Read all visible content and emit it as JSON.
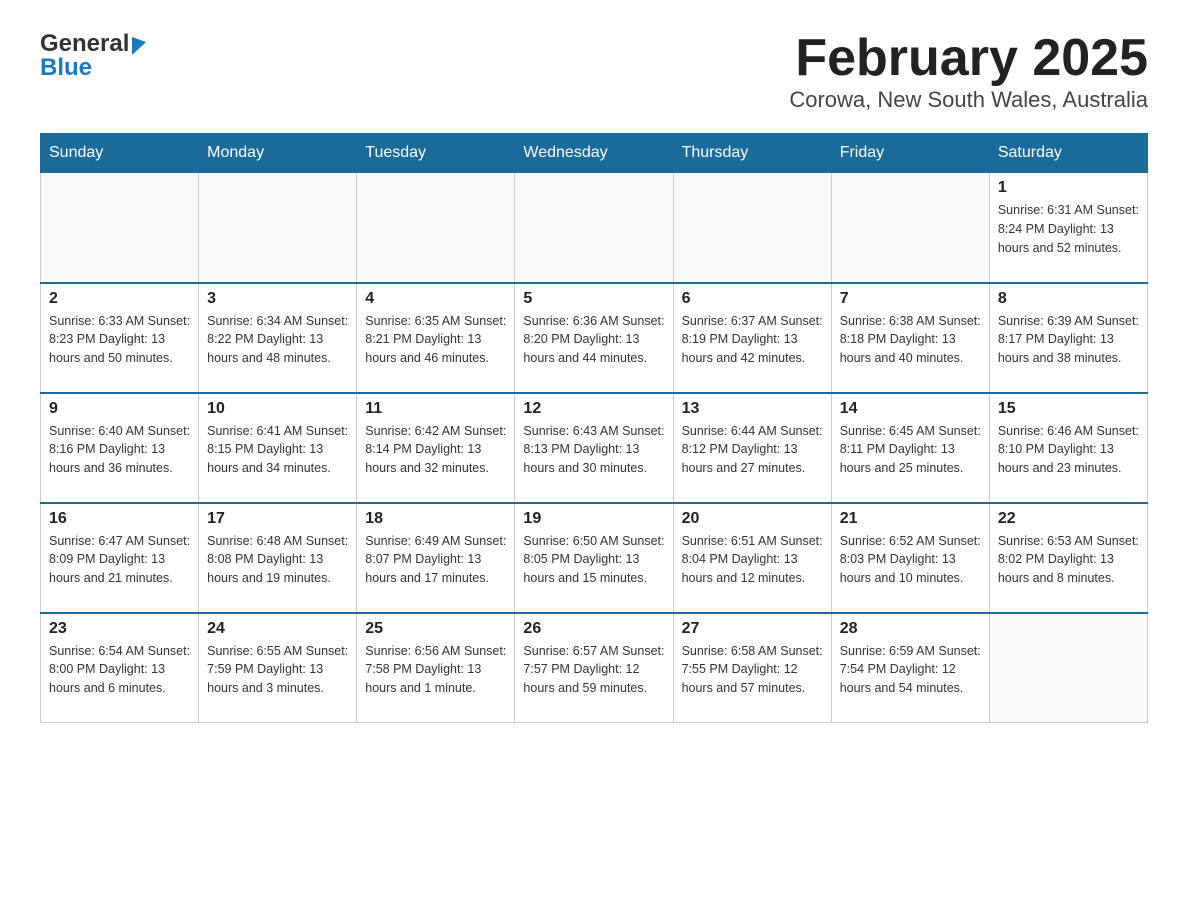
{
  "header": {
    "logo_general": "General",
    "logo_blue": "Blue",
    "title": "February 2025",
    "subtitle": "Corowa, New South Wales, Australia"
  },
  "calendar": {
    "days_of_week": [
      "Sunday",
      "Monday",
      "Tuesday",
      "Wednesday",
      "Thursday",
      "Friday",
      "Saturday"
    ],
    "weeks": [
      [
        {
          "day": "",
          "info": ""
        },
        {
          "day": "",
          "info": ""
        },
        {
          "day": "",
          "info": ""
        },
        {
          "day": "",
          "info": ""
        },
        {
          "day": "",
          "info": ""
        },
        {
          "day": "",
          "info": ""
        },
        {
          "day": "1",
          "info": "Sunrise: 6:31 AM\nSunset: 8:24 PM\nDaylight: 13 hours and 52 minutes."
        }
      ],
      [
        {
          "day": "2",
          "info": "Sunrise: 6:33 AM\nSunset: 8:23 PM\nDaylight: 13 hours and 50 minutes."
        },
        {
          "day": "3",
          "info": "Sunrise: 6:34 AM\nSunset: 8:22 PM\nDaylight: 13 hours and 48 minutes."
        },
        {
          "day": "4",
          "info": "Sunrise: 6:35 AM\nSunset: 8:21 PM\nDaylight: 13 hours and 46 minutes."
        },
        {
          "day": "5",
          "info": "Sunrise: 6:36 AM\nSunset: 8:20 PM\nDaylight: 13 hours and 44 minutes."
        },
        {
          "day": "6",
          "info": "Sunrise: 6:37 AM\nSunset: 8:19 PM\nDaylight: 13 hours and 42 minutes."
        },
        {
          "day": "7",
          "info": "Sunrise: 6:38 AM\nSunset: 8:18 PM\nDaylight: 13 hours and 40 minutes."
        },
        {
          "day": "8",
          "info": "Sunrise: 6:39 AM\nSunset: 8:17 PM\nDaylight: 13 hours and 38 minutes."
        }
      ],
      [
        {
          "day": "9",
          "info": "Sunrise: 6:40 AM\nSunset: 8:16 PM\nDaylight: 13 hours and 36 minutes."
        },
        {
          "day": "10",
          "info": "Sunrise: 6:41 AM\nSunset: 8:15 PM\nDaylight: 13 hours and 34 minutes."
        },
        {
          "day": "11",
          "info": "Sunrise: 6:42 AM\nSunset: 8:14 PM\nDaylight: 13 hours and 32 minutes."
        },
        {
          "day": "12",
          "info": "Sunrise: 6:43 AM\nSunset: 8:13 PM\nDaylight: 13 hours and 30 minutes."
        },
        {
          "day": "13",
          "info": "Sunrise: 6:44 AM\nSunset: 8:12 PM\nDaylight: 13 hours and 27 minutes."
        },
        {
          "day": "14",
          "info": "Sunrise: 6:45 AM\nSunset: 8:11 PM\nDaylight: 13 hours and 25 minutes."
        },
        {
          "day": "15",
          "info": "Sunrise: 6:46 AM\nSunset: 8:10 PM\nDaylight: 13 hours and 23 minutes."
        }
      ],
      [
        {
          "day": "16",
          "info": "Sunrise: 6:47 AM\nSunset: 8:09 PM\nDaylight: 13 hours and 21 minutes."
        },
        {
          "day": "17",
          "info": "Sunrise: 6:48 AM\nSunset: 8:08 PM\nDaylight: 13 hours and 19 minutes."
        },
        {
          "day": "18",
          "info": "Sunrise: 6:49 AM\nSunset: 8:07 PM\nDaylight: 13 hours and 17 minutes."
        },
        {
          "day": "19",
          "info": "Sunrise: 6:50 AM\nSunset: 8:05 PM\nDaylight: 13 hours and 15 minutes."
        },
        {
          "day": "20",
          "info": "Sunrise: 6:51 AM\nSunset: 8:04 PM\nDaylight: 13 hours and 12 minutes."
        },
        {
          "day": "21",
          "info": "Sunrise: 6:52 AM\nSunset: 8:03 PM\nDaylight: 13 hours and 10 minutes."
        },
        {
          "day": "22",
          "info": "Sunrise: 6:53 AM\nSunset: 8:02 PM\nDaylight: 13 hours and 8 minutes."
        }
      ],
      [
        {
          "day": "23",
          "info": "Sunrise: 6:54 AM\nSunset: 8:00 PM\nDaylight: 13 hours and 6 minutes."
        },
        {
          "day": "24",
          "info": "Sunrise: 6:55 AM\nSunset: 7:59 PM\nDaylight: 13 hours and 3 minutes."
        },
        {
          "day": "25",
          "info": "Sunrise: 6:56 AM\nSunset: 7:58 PM\nDaylight: 13 hours and 1 minute."
        },
        {
          "day": "26",
          "info": "Sunrise: 6:57 AM\nSunset: 7:57 PM\nDaylight: 12 hours and 59 minutes."
        },
        {
          "day": "27",
          "info": "Sunrise: 6:58 AM\nSunset: 7:55 PM\nDaylight: 12 hours and 57 minutes."
        },
        {
          "day": "28",
          "info": "Sunrise: 6:59 AM\nSunset: 7:54 PM\nDaylight: 12 hours and 54 minutes."
        },
        {
          "day": "",
          "info": ""
        }
      ]
    ]
  }
}
